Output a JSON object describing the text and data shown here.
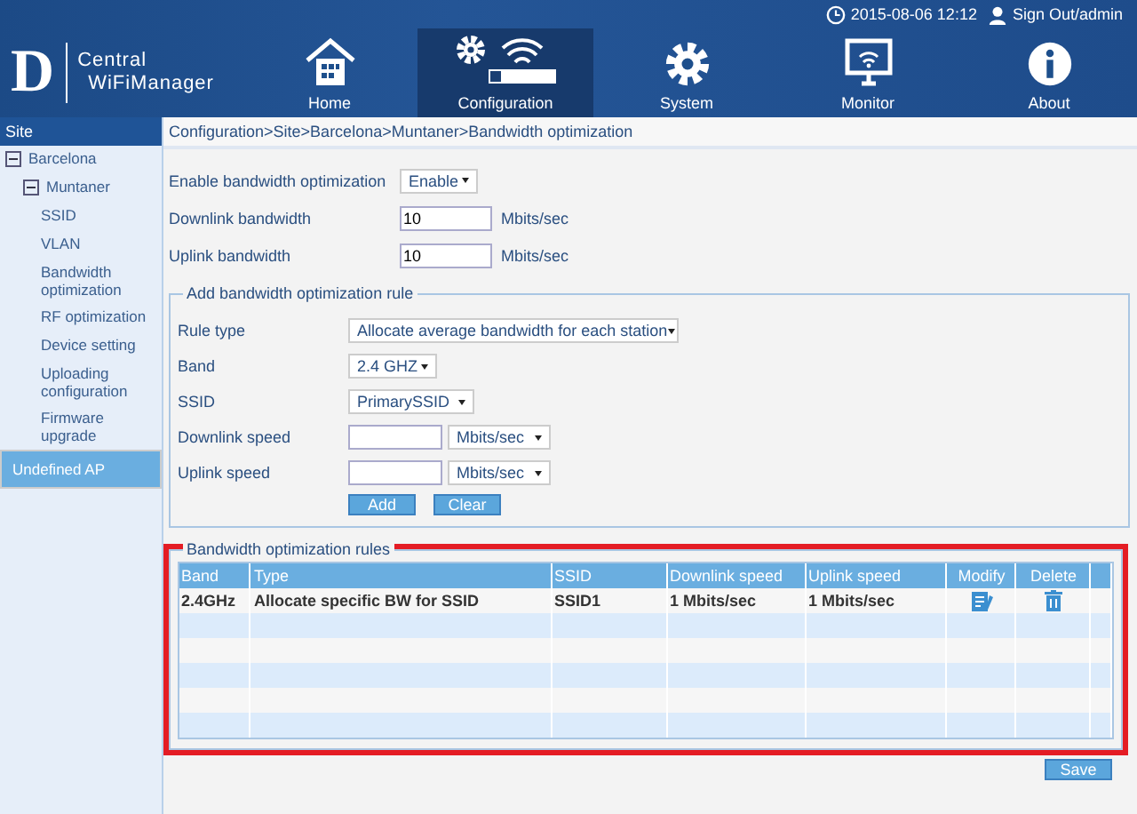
{
  "header": {
    "datetime": "2015-08-06 12:12",
    "sign_out": "Sign Out/admin",
    "logo_lines": [
      "Central",
      "WiFiManager"
    ],
    "logo_letter": "D",
    "nav": [
      {
        "label": "Home",
        "kind": "home",
        "selected": false
      },
      {
        "label": "Configuration",
        "kind": "config",
        "selected": true
      },
      {
        "label": "System",
        "kind": "gear",
        "selected": false
      },
      {
        "label": "Monitor",
        "kind": "monitor",
        "selected": false
      },
      {
        "label": "About",
        "kind": "info",
        "selected": false
      }
    ]
  },
  "sidebar": {
    "title": "Site",
    "items": [
      {
        "label": "Barcelona",
        "expanded": true,
        "selected": false,
        "children": [
          {
            "label": "Muntaner",
            "expanded": true,
            "selected": false,
            "children": [
              {
                "label": "SSID",
                "selected": false
              },
              {
                "label": "VLAN",
                "selected": false
              },
              {
                "label": "Bandwidth optimization",
                "selected": false
              },
              {
                "label": "RF optimization",
                "selected": false
              },
              {
                "label": "Device setting",
                "selected": false
              },
              {
                "label": "Uploading configuration",
                "selected": false
              },
              {
                "label": "Firmware upgrade",
                "selected": false
              }
            ]
          }
        ]
      },
      {
        "label": "Undefined AP",
        "selected": true
      }
    ]
  },
  "breadcrumb": "Configuration>Site>Barcelona>Muntaner>Bandwidth optimization",
  "settings": [
    {
      "label": "Enable bandwidth optimization",
      "kind": "select",
      "value": "Enable"
    },
    {
      "label": "Downlink bandwidth",
      "kind": "input",
      "value": "10",
      "unit": "Mbits/sec"
    },
    {
      "label": "Uplink bandwidth",
      "kind": "input",
      "value": "10",
      "unit": "Mbits/sec"
    }
  ],
  "add_rule": {
    "legend": "Add bandwidth optimization rule",
    "fields": [
      {
        "label": "Rule type",
        "kind": "select",
        "value": "Allocate average bandwidth for each station"
      },
      {
        "label": "Band",
        "kind": "select",
        "value": "2.4 GHZ"
      },
      {
        "label": "SSID",
        "kind": "select",
        "value": "PrimarySSID"
      },
      {
        "label": "Downlink speed",
        "kind": "speed",
        "unit": "Mbits/sec"
      },
      {
        "label": "Uplink speed",
        "kind": "speed",
        "unit": "Mbits/sec"
      }
    ],
    "buttons": [
      "Add",
      "Clear"
    ]
  },
  "rules": {
    "legend": "Bandwidth optimization rules",
    "columns": [
      "Band",
      "Type",
      "SSID",
      "Downlink speed",
      "Uplink speed",
      "Modify",
      "Delete"
    ],
    "rows": [
      {
        "band": "2.4GHz",
        "type": "Allocate specific BW for SSID",
        "ssid": "SSID1",
        "downlink": "1 Mbits/sec",
        "uplink": "1 Mbits/sec"
      }
    ]
  },
  "save_button": "Save",
  "highlight": true
}
